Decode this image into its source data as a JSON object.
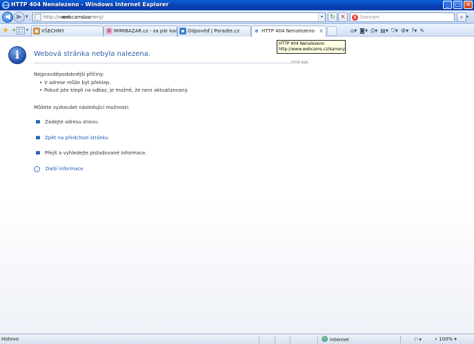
{
  "window": {
    "title": "HTTP 404 Nenalezeno - Windows Internet Explorer",
    "minimize": "_",
    "maximize": "□",
    "close": "✕"
  },
  "address": {
    "url_prefix": "http://www.",
    "url_host": "webcams.cz",
    "url_path": "/kamery/",
    "dropdown": "▾",
    "refresh": "↻",
    "stop": "✕"
  },
  "search": {
    "placeholder": "Seznam",
    "provider_letter": "S",
    "button": "⌕",
    "dropdown": "▾"
  },
  "favorites": {
    "star": "★",
    "add": "+"
  },
  "tabs": [
    {
      "label": "VŠECHNY",
      "icon": "folder-icon"
    },
    {
      "label": "MIMIBAZAR.cz - za pár kačk...",
      "icon": "site-icon"
    },
    {
      "label": "Odpověď | Poradte.cz",
      "icon": "site-icon"
    },
    {
      "label": "HTTP 404 Nenalezeno",
      "icon": "ie-icon",
      "close": "x",
      "active": true
    }
  ],
  "command_bar": [
    {
      "name": "home-icon",
      "glyph": "⌂▾"
    },
    {
      "name": "feeds-icon",
      "glyph": "◙▾"
    },
    {
      "name": "print-icon",
      "glyph": "⎙▾"
    },
    {
      "name": "page-icon",
      "glyph": "▤▾"
    },
    {
      "name": "safety-icon",
      "glyph": "⛉▾"
    },
    {
      "name": "tools-icon",
      "glyph": "⚙▾"
    },
    {
      "name": "help-icon",
      "glyph": "?▾"
    },
    {
      "name": "research-icon",
      "glyph": "✎"
    }
  ],
  "page": {
    "info_letter": "i",
    "title": "Webová stránka nebyla nalezena.",
    "http_code": "HTTP 404",
    "causes_heading": "Nejpravděpodobnější příčiny:",
    "causes": [
      "V adrese může být překlep.",
      "Pokud jste klepli na odkaz, je možné, že není aktualizovaný."
    ],
    "options_heading": "Můžete vyzkoušet následující možnosti:",
    "options": [
      {
        "text": "Zadejte adresu znovu.",
        "link": false
      },
      {
        "text": "Zpět na předchozí stránku",
        "link": true
      },
      {
        "text": "Přejít  a vyhledejte požadované informace.",
        "link": false
      }
    ],
    "more_info": "Další informace",
    "more_glyph": "⌄"
  },
  "tooltip": {
    "line1": "HTTP 404 Nenalezeno",
    "line2": "http://www.webcams.cz/kamery/"
  },
  "status": {
    "text": "Hotovo",
    "zone": "Internet",
    "zoom": "100%",
    "zoom_dropdown": "▾"
  },
  "colors": {
    "title_blue": "#2d5da8",
    "link_blue": "#1f58b8",
    "titlebar": "#0a3fb3"
  }
}
